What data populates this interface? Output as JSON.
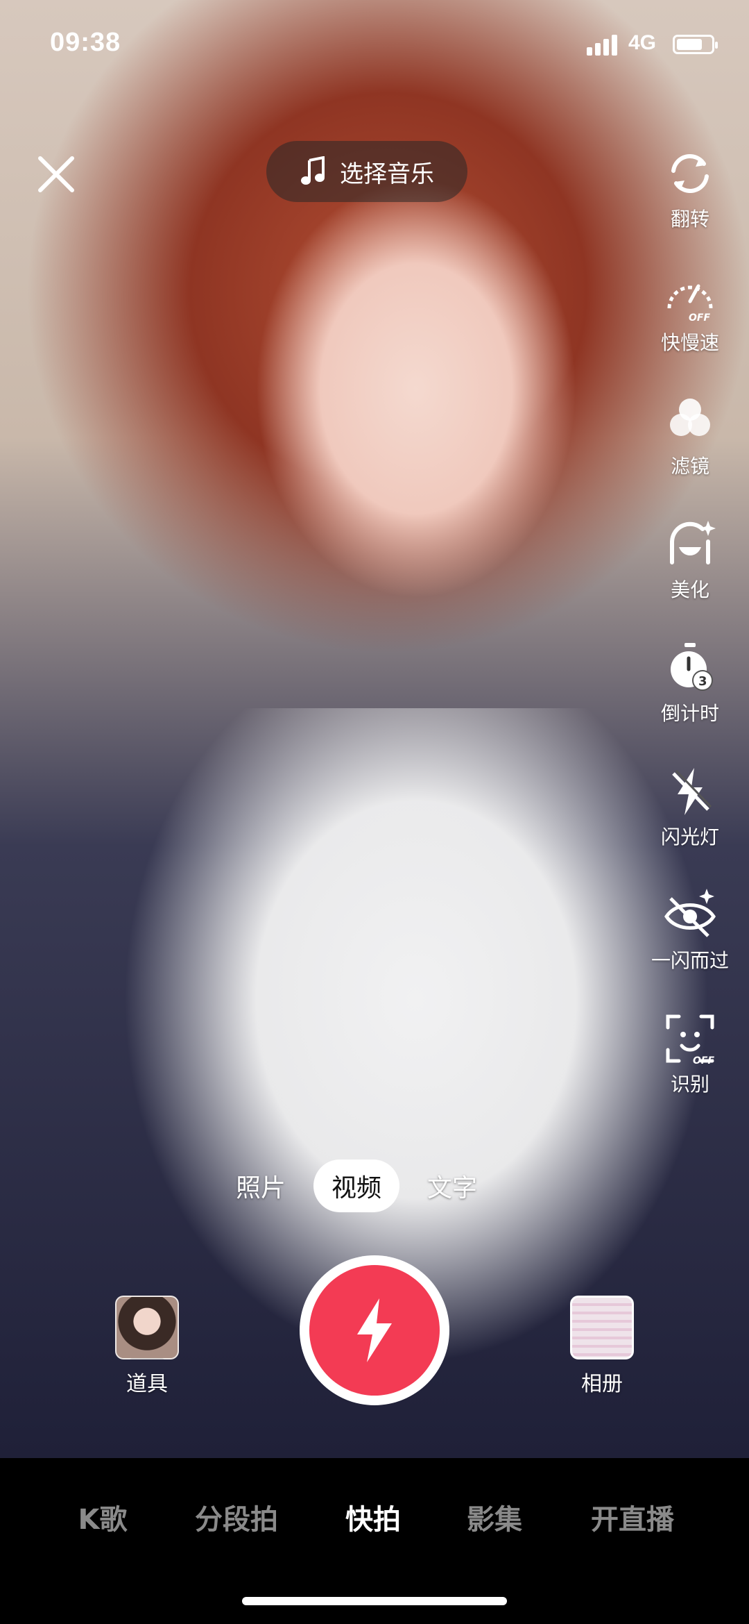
{
  "status_bar": {
    "time": "09:38",
    "network": "4G",
    "battery_level": 0.75
  },
  "music": {
    "label": "选择音乐",
    "icon": "music-note-icon"
  },
  "side_tools": [
    {
      "label": "翻转",
      "icon": "flip-camera-icon"
    },
    {
      "label": "快慢速",
      "icon": "speed-off-icon"
    },
    {
      "label": "滤镜",
      "icon": "filter-icon"
    },
    {
      "label": "美化",
      "icon": "beautify-icon"
    },
    {
      "label": "倒计时",
      "icon": "countdown-timer-icon"
    },
    {
      "label": "闪光灯",
      "icon": "flash-off-icon"
    },
    {
      "label": "一闪而过",
      "icon": "flash-glimpse-icon"
    },
    {
      "label": "识别",
      "icon": "face-recognition-off-icon"
    }
  ],
  "capture_modes": {
    "items": [
      "照片",
      "视频",
      "文字"
    ],
    "selected": "视频"
  },
  "props": {
    "label": "道具"
  },
  "album": {
    "label": "相册"
  },
  "bottom_nav": {
    "items": [
      "K歌",
      "分段拍",
      "快拍",
      "影集",
      "开直播"
    ],
    "selected": "快拍"
  },
  "colors": {
    "shutter": "#f33b54",
    "active_text": "#ffffff",
    "inactive_text": "#8a8a8a"
  }
}
